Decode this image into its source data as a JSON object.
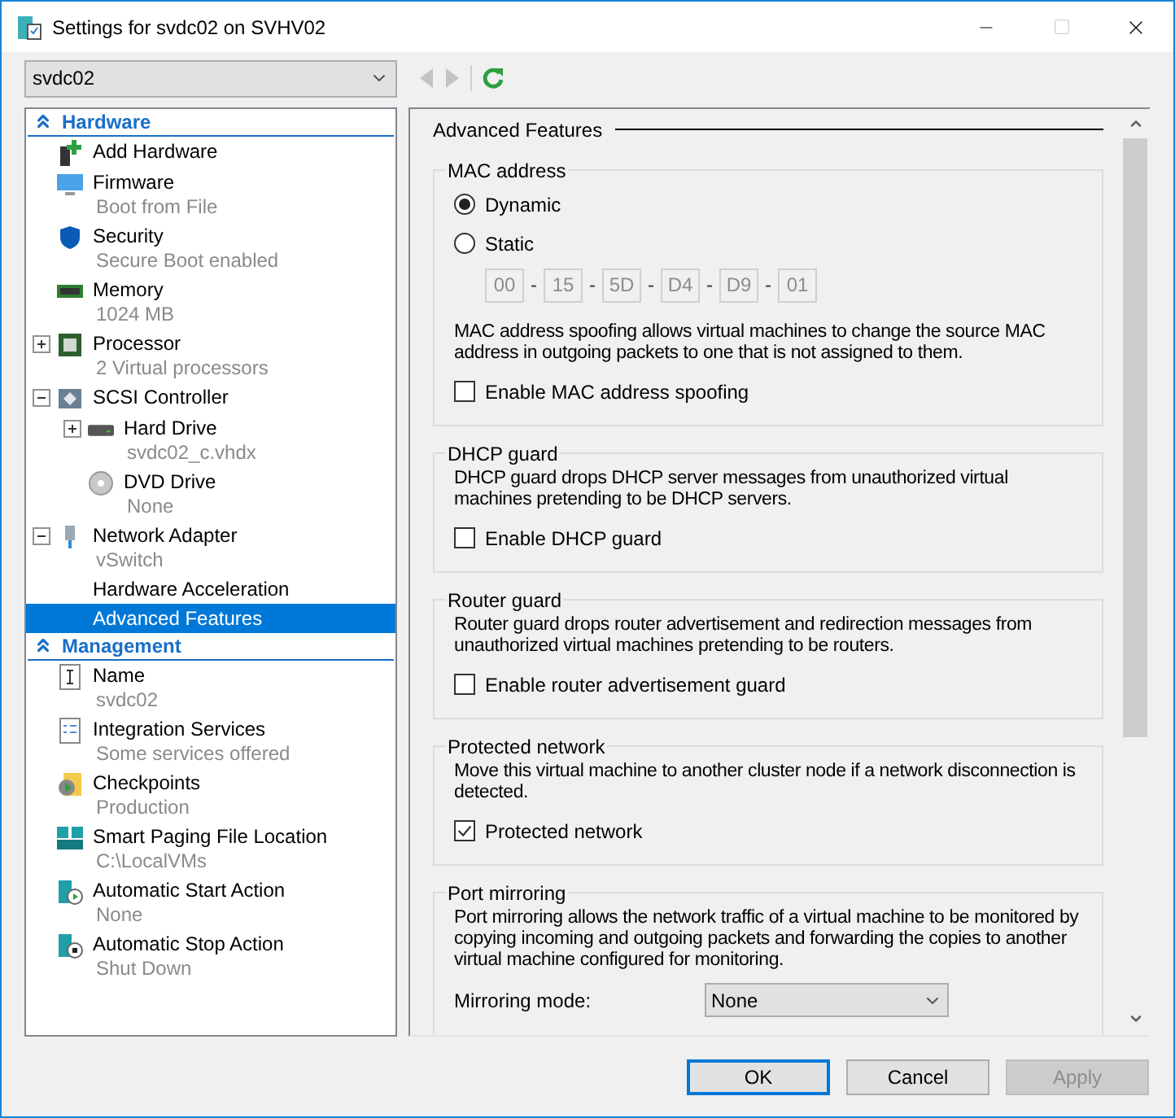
{
  "window": {
    "title": "Settings for svdc02 on SVHV02"
  },
  "vm_select": {
    "value": "svdc02"
  },
  "tree": [
    {
      "label": "Hardware",
      "expanded": true,
      "items": [
        {
          "label": "Add Hardware",
          "selected": false
        },
        {
          "label": "Firmware",
          "detail": "Boot from File",
          "selected": false
        },
        {
          "label": "Security",
          "detail": "Secure Boot enabled",
          "selected": false
        },
        {
          "label": "Memory",
          "detail": "1024 MB",
          "selected": false
        },
        {
          "label": "Processor",
          "detail": "2 Virtual processors",
          "expanded": false,
          "selected": false
        },
        {
          "label": "SCSI Controller",
          "expanded": true,
          "selected": false,
          "children": [
            {
              "label": "Hard Drive",
              "detail": "svdc02_c.vhdx",
              "expanded": false,
              "selected": false
            },
            {
              "label": "DVD Drive",
              "detail": "None",
              "selected": false
            }
          ]
        },
        {
          "label": "Network Adapter",
          "detail": "vSwitch",
          "expanded": true,
          "selected": false,
          "children": [
            {
              "label": "Hardware Acceleration",
              "selected": false
            },
            {
              "label": "Advanced Features",
              "selected": true
            }
          ]
        }
      ]
    },
    {
      "label": "Management",
      "expanded": true,
      "items": [
        {
          "label": "Name",
          "detail": "svdc02",
          "selected": false
        },
        {
          "label": "Integration Services",
          "detail": "Some services offered",
          "selected": false
        },
        {
          "label": "Checkpoints",
          "detail": "Production",
          "selected": false
        },
        {
          "label": "Smart Paging File Location",
          "detail": "C:\\LocalVMs",
          "selected": false
        },
        {
          "label": "Automatic Start Action",
          "detail": "None",
          "selected": false
        },
        {
          "label": "Automatic Stop Action",
          "detail": "Shut Down",
          "selected": false
        }
      ]
    }
  ],
  "panel": {
    "heading": "Advanced Features",
    "groups": [
      {
        "title": "MAC address",
        "rows": [
          {
            "kind": "radio",
            "label": "Dynamic",
            "selected": true
          },
          {
            "kind": "radio",
            "label": "Static",
            "selected": false
          },
          {
            "kind": "mac",
            "disabled": true,
            "octets": [
              "00",
              "15",
              "5D",
              "D4",
              "D9",
              "01"
            ],
            "separator": "-"
          },
          {
            "kind": "text",
            "text": "MAC address spoofing allows virtual machines to change the source MAC address in outgoing packets to one that is not assigned to them."
          },
          {
            "kind": "checkbox",
            "label": "Enable MAC address spoofing",
            "checked": false
          }
        ]
      },
      {
        "title": "DHCP guard",
        "rows": [
          {
            "kind": "text",
            "text": "DHCP guard drops DHCP server messages from unauthorized virtual machines pretending to be DHCP servers."
          },
          {
            "kind": "checkbox",
            "label": "Enable DHCP guard",
            "checked": false
          }
        ]
      },
      {
        "title": "Router guard",
        "rows": [
          {
            "kind": "text",
            "text": "Router guard drops router advertisement and redirection messages from unauthorized virtual machines pretending to be routers."
          },
          {
            "kind": "checkbox",
            "label": "Enable router advertisement guard",
            "checked": false
          }
        ]
      },
      {
        "title": "Protected network",
        "rows": [
          {
            "kind": "text",
            "text": "Move this virtual machine to another cluster node if a network disconnection is detected."
          },
          {
            "kind": "checkbox",
            "label": "Protected network",
            "checked": true
          }
        ]
      },
      {
        "title": "Port mirroring",
        "rows": [
          {
            "kind": "text",
            "text": "Port mirroring allows the network traffic of a virtual machine to be monitored by copying incoming and outgoing packets and forwarding the copies to another virtual machine configured for monitoring."
          },
          {
            "kind": "select",
            "label": "Mirroring mode:",
            "value": "None"
          }
        ]
      }
    ]
  },
  "buttons": [
    {
      "label": "OK",
      "default": true,
      "disabled": false
    },
    {
      "label": "Cancel",
      "default": false,
      "disabled": false
    },
    {
      "label": "Apply",
      "default": false,
      "disabled": true
    }
  ]
}
